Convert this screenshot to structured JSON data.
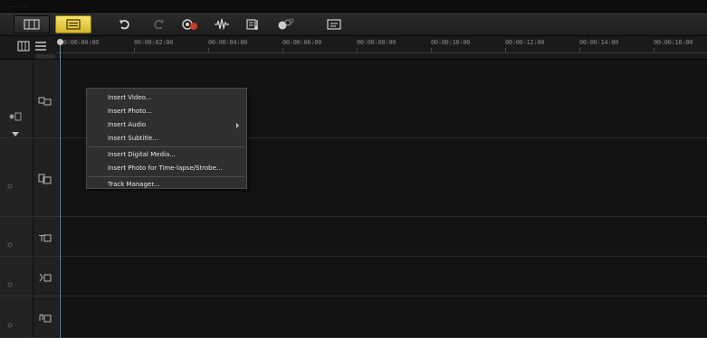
{
  "top_bar": {
    "grip": "........"
  },
  "toolbar": {
    "view_buttons": [
      {
        "name": "storyboard-view",
        "icon": "storyboard-icon",
        "active": false
      },
      {
        "name": "timeline-view",
        "icon": "timeline-icon",
        "active": true
      }
    ],
    "tools": [
      {
        "name": "undo",
        "icon": "undo-icon",
        "enabled": true
      },
      {
        "name": "redo",
        "icon": "redo-icon",
        "enabled": false
      },
      {
        "name": "record-capture",
        "icon": "record-icon",
        "enabled": true
      },
      {
        "name": "sound-mixer",
        "icon": "audio-wave-icon",
        "enabled": true
      },
      {
        "name": "auto-music",
        "icon": "auto-music-icon",
        "enabled": true
      },
      {
        "name": "motion-tracking",
        "icon": "motion-icon",
        "enabled": true
      },
      {
        "name": "subtitle-editor",
        "icon": "subtitle-icon",
        "enabled": true
      }
    ],
    "active_color": "#e8cc45"
  },
  "timeline": {
    "timecodes": [
      "00:00:00:00",
      "00:00:02:00",
      "00:00:04:00",
      "00:00:06:00",
      "00:00:08:00",
      "00:00:10:00",
      "00:00:12:00",
      "00:00:14:00",
      "00:00:16:00"
    ],
    "tracks": [
      {
        "name": "video-track",
        "icon": "video-track-icon"
      },
      {
        "name": "overlay-track",
        "icon": "overlay-track-icon"
      },
      {
        "name": "title-track",
        "icon": "title-track-icon"
      },
      {
        "name": "voice-track",
        "icon": "voice-track-icon"
      },
      {
        "name": "music-track",
        "icon": "music-track-icon"
      }
    ],
    "playhead_color": "#6a88b2"
  },
  "context_menu": {
    "items": [
      {
        "label": "Insert Video...",
        "submenu": false
      },
      {
        "label": "Insert Photo...",
        "submenu": false
      },
      {
        "label": "Insert Audio",
        "submenu": true
      },
      {
        "label": "Insert Subtitle...",
        "submenu": false
      },
      {
        "separator": true
      },
      {
        "label": "Insert Digital Media...",
        "submenu": false
      },
      {
        "label": "Insert Photo for Time-lapse/Strobe...",
        "submenu": false
      },
      {
        "separator": true
      },
      {
        "label": "Track Manager...",
        "submenu": false
      }
    ]
  }
}
